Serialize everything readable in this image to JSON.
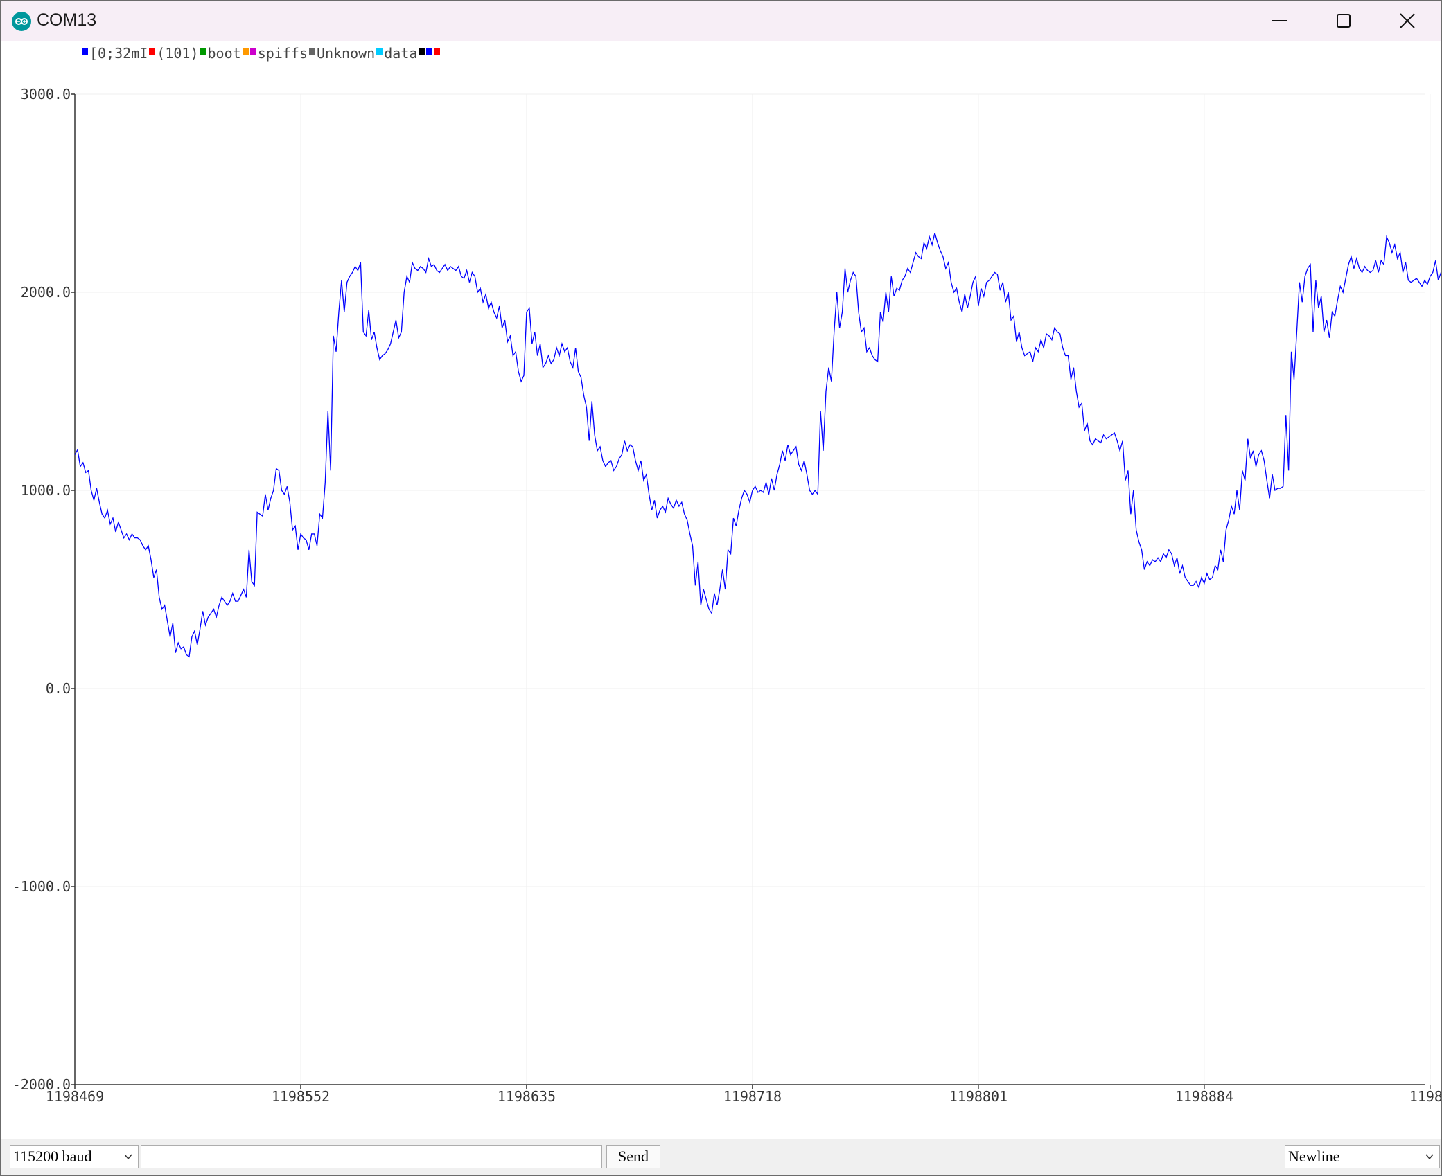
{
  "window": {
    "title": "COM13",
    "app_icon": "arduino-infinity-icon",
    "controls": {
      "minimize": "minimize-icon",
      "maximize": "maximize-icon",
      "close": "close-icon"
    }
  },
  "legend": [
    {
      "label": "[0;32mI",
      "color": "#0000ff"
    },
    {
      "label": "(101)",
      "color": "#ff0000"
    },
    {
      "label": "boot",
      "color": "#009900"
    },
    {
      "label": "",
      "color": "#ff9900"
    },
    {
      "label": "spiffs",
      "color": "#cc00cc"
    },
    {
      "label": "Unknown",
      "color": "#666666"
    },
    {
      "label": "data",
      "color": "#00ccff"
    },
    {
      "label": "",
      "color": "#000000"
    },
    {
      "label": "",
      "color": "#0000ff"
    },
    {
      "label": "",
      "color": "#ff0000"
    }
  ],
  "chart_data": {
    "type": "line",
    "title": "",
    "xlabel": "",
    "ylabel": "",
    "grid": true,
    "legend_position": "top-left",
    "ylim": [
      -2000,
      3000
    ],
    "xlim": [
      1198469,
      1198965
    ],
    "y_ticks": [
      "3000.0",
      "2000.0",
      "1000.0",
      "0.0",
      "-1000.0",
      "-2000.0"
    ],
    "x_ticks": [
      "1198469",
      "1198552",
      "1198635",
      "1198718",
      "1198801",
      "1198884",
      "11989"
    ],
    "series": [
      {
        "color": "#0000ff",
        "x_start": 1198469,
        "x_step": 1,
        "values": [
          1180,
          1205,
          1120,
          1140,
          1090,
          1100,
          1000,
          950,
          1010,
          940,
          880,
          860,
          900,
          830,
          860,
          790,
          840,
          800,
          760,
          780,
          750,
          780,
          760,
          760,
          750,
          720,
          700,
          720,
          650,
          560,
          600,
          460,
          400,
          420,
          340,
          260,
          330,
          180,
          230,
          200,
          210,
          170,
          160,
          260,
          290,
          220,
          300,
          390,
          320,
          360,
          380,
          400,
          360,
          420,
          460,
          440,
          420,
          440,
          480,
          440,
          440,
          470,
          500,
          460,
          700,
          540,
          520,
          890,
          880,
          870,
          980,
          900,
          960,
          1000,
          1110,
          1100,
          1000,
          980,
          1020,
          940,
          800,
          820,
          700,
          780,
          760,
          750,
          700,
          780,
          780,
          720,
          880,
          860,
          1040,
          1400,
          1100,
          1780,
          1700,
          1900,
          2060,
          1900,
          2050,
          2080,
          2100,
          2130,
          2110,
          2150,
          1800,
          1780,
          1910,
          1760,
          1800,
          1720,
          1660,
          1680,
          1690,
          1710,
          1740,
          1800,
          1860,
          1770,
          1800,
          2000,
          2080,
          2050,
          2150,
          2120,
          2110,
          2130,
          2120,
          2100,
          2170,
          2130,
          2140,
          2110,
          2100,
          2120,
          2140,
          2110,
          2130,
          2120,
          2110,
          2130,
          2080,
          2070,
          2110,
          2050,
          2100,
          2080,
          2000,
          2020,
          1950,
          1990,
          1920,
          1950,
          1900,
          1870,
          1930,
          1820,
          1860,
          1750,
          1780,
          1680,
          1700,
          1600,
          1550,
          1580,
          1900,
          1920,
          1740,
          1800,
          1680,
          1740,
          1620,
          1640,
          1680,
          1640,
          1660,
          1720,
          1680,
          1740,
          1700,
          1720,
          1650,
          1620,
          1720,
          1600,
          1570,
          1480,
          1420,
          1250,
          1450,
          1280,
          1200,
          1220,
          1150,
          1120,
          1140,
          1150,
          1100,
          1120,
          1160,
          1180,
          1250,
          1200,
          1230,
          1220,
          1150,
          1100,
          1150,
          1050,
          1080,
          980,
          900,
          950,
          860,
          900,
          920,
          890,
          960,
          930,
          910,
          950,
          920,
          940,
          880,
          850,
          780,
          720,
          520,
          640,
          420,
          500,
          450,
          400,
          380,
          480,
          420,
          500,
          600,
          500,
          700,
          680,
          860,
          820,
          900,
          960,
          1000,
          980,
          940,
          1000,
          1020,
          990,
          1000,
          990,
          1040,
          980,
          1060,
          1000,
          1080,
          1130,
          1200,
          1150,
          1230,
          1180,
          1200,
          1220,
          1130,
          1100,
          1150,
          1080,
          1000,
          980,
          1000,
          980,
          1400,
          1200,
          1500,
          1620,
          1550,
          1800,
          2000,
          1820,
          1900,
          2120,
          2000,
          2060,
          2100,
          2080,
          1900,
          1800,
          1820,
          1700,
          1720,
          1680,
          1660,
          1650,
          1900,
          1850,
          2000,
          1900,
          2080,
          1980,
          2020,
          2010,
          2060,
          2080,
          2120,
          2100,
          2150,
          2200,
          2180,
          2170,
          2250,
          2220,
          2280,
          2240,
          2300,
          2250,
          2210,
          2180,
          2120,
          2150,
          2050,
          2000,
          2020,
          1950,
          1900,
          1990,
          1920,
          1980,
          2050,
          2080,
          1930,
          2020,
          1980,
          2050,
          2060,
          2080,
          2100,
          2090,
          2010,
          2050,
          1950,
          2000,
          1860,
          1880,
          1750,
          1800,
          1720,
          1680,
          1690,
          1700,
          1650,
          1720,
          1700,
          1760,
          1720,
          1790,
          1780,
          1760,
          1820,
          1800,
          1790,
          1720,
          1680,
          1680,
          1560,
          1620,
          1500,
          1420,
          1440,
          1300,
          1340,
          1250,
          1230,
          1260,
          1250,
          1240,
          1280,
          1260,
          1270,
          1280,
          1290,
          1250,
          1200,
          1250,
          1050,
          1100,
          880,
          1000,
          800,
          740,
          700,
          600,
          640,
          620,
          650,
          640,
          660,
          640,
          680,
          660,
          700,
          680,
          620,
          660,
          580,
          620,
          560,
          540,
          520,
          520,
          540,
          510,
          560,
          530,
          580,
          550,
          560,
          620,
          600,
          700,
          640,
          800,
          850,
          920,
          880,
          1000,
          900,
          1100,
          1050,
          1260,
          1160,
          1200,
          1120,
          1180,
          1200,
          1150,
          1050,
          960,
          1080,
          1000,
          1010,
          1010,
          1020,
          1380,
          1100,
          1700,
          1560,
          1800,
          2050,
          1950,
          2080,
          2120,
          2140,
          1800,
          2060,
          1920,
          1980,
          1800,
          1860,
          1770,
          1900,
          1880,
          1960,
          2030,
          2000,
          2070,
          2140,
          2180,
          2120,
          2170,
          2120,
          2100,
          2130,
          2110,
          2100,
          2110,
          2160,
          2100,
          2160,
          2140,
          2280,
          2250,
          2200,
          2240,
          2170,
          2200,
          2100,
          2150,
          2060,
          2050,
          2060,
          2070,
          2050,
          2030,
          2060,
          2040,
          2080,
          2100,
          2160,
          2060,
          2100,
          2130,
          2200,
          2100,
          2170,
          2000,
          2040,
          1800,
          1880,
          1700,
          1620,
          1650,
          1580,
          1600,
          1560,
          1620,
          1680,
          1640,
          1700,
          1640,
          1690,
          1650,
          1600,
          1500,
          1440,
          1420,
          1260,
          1300,
          1200,
          1220,
          1230,
          1180,
          1200,
          1180,
          1250,
          1200,
          1280,
          1250,
          1220,
          1160,
          1050,
          1000,
          1120,
          900,
          820,
          820,
          810,
          800,
          790,
          780,
          800,
          760,
          780,
          710,
          720,
          700,
          660,
          640,
          650,
          640,
          700,
          720,
          780,
          820,
          900,
          820,
          940,
          1000,
          1100,
          1050,
          1180,
          1150,
          1300,
          1260,
          1270,
          1320,
          1300,
          1340,
          1280,
          1200,
          1250,
          1200,
          1160,
          1120,
          1140,
          1100,
          1450,
          1220,
          1700,
          1600,
          2100,
          1900,
          2280,
          2200,
          2220,
          2180,
          2150,
          2000,
          2100,
          1950,
          1850,
          1900,
          1800,
          1880,
          2000,
          2250,
          2120,
          2050,
          2220,
          2180,
          2100,
          2200,
          2080,
          2040,
          2020,
          2000,
          1960,
          2000,
          2050,
          2000,
          2100,
          2200,
          2120,
          2180,
          2250,
          2180,
          2200
        ]
      }
    ]
  },
  "bottombar": {
    "baud": {
      "selected": "115200 baud"
    },
    "input": {
      "value": "",
      "placeholder": ""
    },
    "send_label": "Send",
    "line_ending": {
      "selected": "Newline"
    }
  }
}
